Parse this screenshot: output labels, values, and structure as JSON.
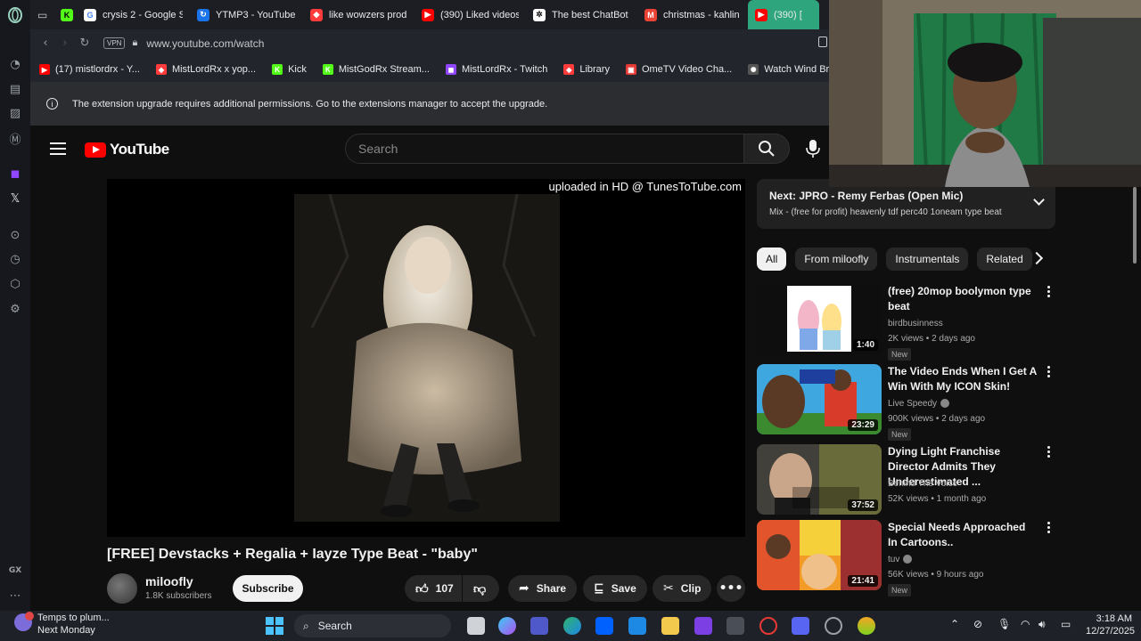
{
  "tabs": [
    {
      "title": "crysis 2 - Google S",
      "fav": "G",
      "color": "#ffffff",
      "fg": "#4285f4"
    },
    {
      "title": "YTMP3 - YouTube",
      "fav": "↻",
      "color": "#1a73e8",
      "fg": "#ffffff"
    },
    {
      "title": "like wowzers prod",
      "fav": "◆",
      "color": "#ff3b3b",
      "fg": "#ffffff"
    },
    {
      "title": "(390) Liked videos",
      "fav": "▶",
      "color": "#ff0000",
      "fg": "#ffffff"
    },
    {
      "title": "The best ChatBot",
      "fav": "✲",
      "color": "#ffffff",
      "fg": "#111111"
    },
    {
      "title": "christmas - kahlin",
      "fav": "M",
      "color": "#ea4335",
      "fg": "#ffffff"
    },
    {
      "title": "(390) [",
      "fav": "▶",
      "color": "#ff0000",
      "fg": "#ffffff",
      "active": true
    }
  ],
  "address": {
    "url": "www.youtube.com/watch",
    "vpn": "VPN"
  },
  "bookmarks": [
    {
      "label": "(17) mistlordrx - Y...",
      "fav": "▶",
      "color": "#ff0000"
    },
    {
      "label": "MistLordRx x yop...",
      "fav": "◆",
      "color": "#ff3b3b"
    },
    {
      "label": "Kick",
      "fav": "K",
      "color": "#53fc18"
    },
    {
      "label": "MistGodRx Stream...",
      "fav": "K",
      "color": "#53fc18"
    },
    {
      "label": "MistLordRx - Twitch",
      "fav": "◼",
      "color": "#9146ff"
    },
    {
      "label": "Library",
      "fav": "◆",
      "color": "#ff3b3b"
    },
    {
      "label": "OmeTV Video Cha...",
      "fav": "▣",
      "color": "#e53935"
    },
    {
      "label": "Watch Wind Break...",
      "fav": "✺",
      "color": "#555555"
    }
  ],
  "notice": {
    "text": "The extension upgrade requires additional permissions. Go to the extensions manager to accept the upgrade."
  },
  "youtube": {
    "logo_text": "YouTube",
    "search_placeholder": "Search",
    "watermark": "uploaded in HD @ TunesToTube.com",
    "video_title": "[FREE] Devstacks + Regalia + Iayze Type Beat - \"baby\"",
    "channel": "miloofly",
    "subscribers": "1.8K subscribers",
    "subscribe": "Subscribe",
    "likes": "107",
    "share": "Share",
    "save": "Save",
    "clip": "Clip"
  },
  "next": {
    "title": "Next: JPRO - Remy Ferbas (Open Mic)",
    "subtitle": "Mix - (free for profit) heavenly tdf perc40 1oneam type beat"
  },
  "chips": [
    "All",
    "From miloofly",
    "Instrumentals",
    "Related"
  ],
  "recommendations": [
    {
      "title": "(free) 20mop boolymon type beat",
      "channel": "birdbusinness",
      "meta": "2K views • 2 days ago",
      "badge": "New",
      "duration": "1:40",
      "verified": false
    },
    {
      "title": "The Video Ends When I Get A Win With My ICON Skin!",
      "channel": "Live Speedy",
      "meta": "900K views • 2 days ago",
      "badge": "New",
      "duration": "23:29",
      "verified": true
    },
    {
      "title": "Dying Light Franchise Director Admits They Underestimated ...",
      "channel": "Behind The Voice",
      "meta": "52K views • 1 month ago",
      "badge": "",
      "duration": "37:52",
      "verified": false
    },
    {
      "title": "Special Needs Approached In Cartoons..",
      "channel": "tuv",
      "meta": "56K views • 9 hours ago",
      "badge": "New",
      "duration": "21:41",
      "verified": true
    }
  ],
  "taskbar": {
    "weather_line1": "Temps to plum...",
    "weather_line2": "Next Monday",
    "search": "Search",
    "time": "3:18 AM",
    "date": "12/27/2025"
  }
}
